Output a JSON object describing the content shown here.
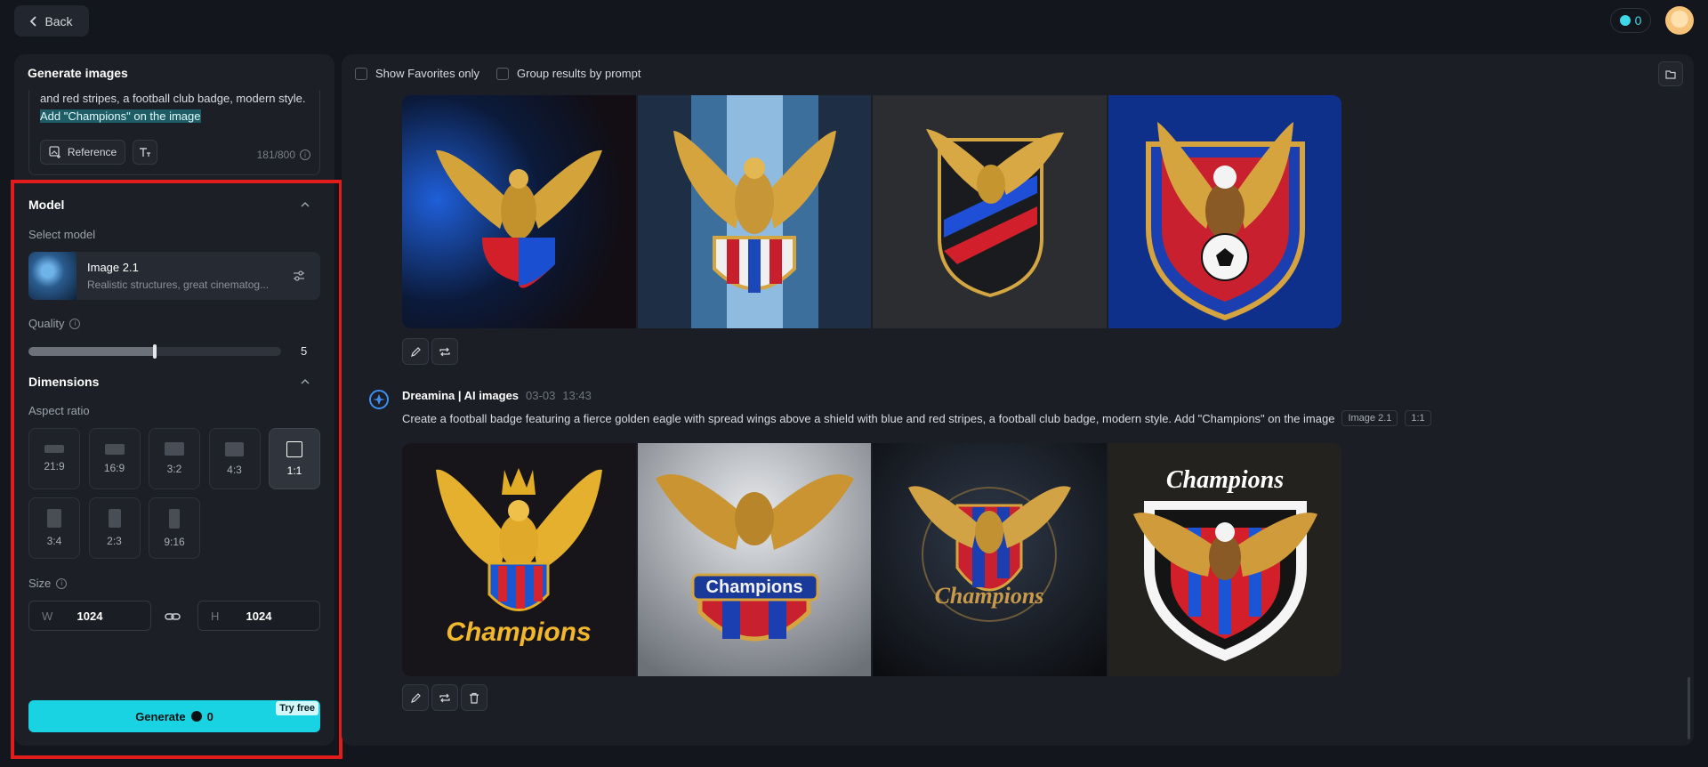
{
  "topbar": {
    "back_label": "Back",
    "credits": "0"
  },
  "panel": {
    "title": "Generate images",
    "prompt_visible": "and red stripes, a football club badge, modern style.",
    "prompt_highlight": "Add \"Champions\" on the image",
    "reference_label": "Reference",
    "char_count": "181/800"
  },
  "model": {
    "section_label": "Model",
    "select_label": "Select model",
    "name": "Image 2.1",
    "description": "Realistic structures, great cinematog..."
  },
  "quality": {
    "label": "Quality",
    "value": "5",
    "level_fraction": 0.5
  },
  "dimensions": {
    "section_label": "Dimensions",
    "aspect_label": "Aspect ratio",
    "ratios": [
      "21:9",
      "16:9",
      "3:2",
      "4:3",
      "1:1",
      "3:4",
      "2:3",
      "9:16"
    ],
    "selected_ratio": "1:1",
    "size_label": "Size",
    "width_prefix": "W",
    "width": "1024",
    "height_prefix": "H",
    "height": "1024"
  },
  "generate": {
    "label": "Generate",
    "cost": "0",
    "badge": "Try free"
  },
  "filters": {
    "favorites_label": "Show Favorites only",
    "group_label": "Group results by prompt"
  },
  "generation": {
    "author": "Dreamina | AI images",
    "date": "03-03",
    "time": "13:43",
    "prompt": "Create a football badge featuring a fierce golden eagle with spread wings above a shield with blue and red stripes, a football club badge, modern style. Add \"Champions\" on the image",
    "model_tag": "Image 2.1",
    "ratio_tag": "1:1",
    "image_texts": [
      "Champions",
      "Champions",
      "Champions",
      "Champions"
    ]
  },
  "colors": {
    "accent": "#1ad3e2",
    "highlight_frame": "#e21b1b",
    "panel_bg": "#1c1f26"
  }
}
